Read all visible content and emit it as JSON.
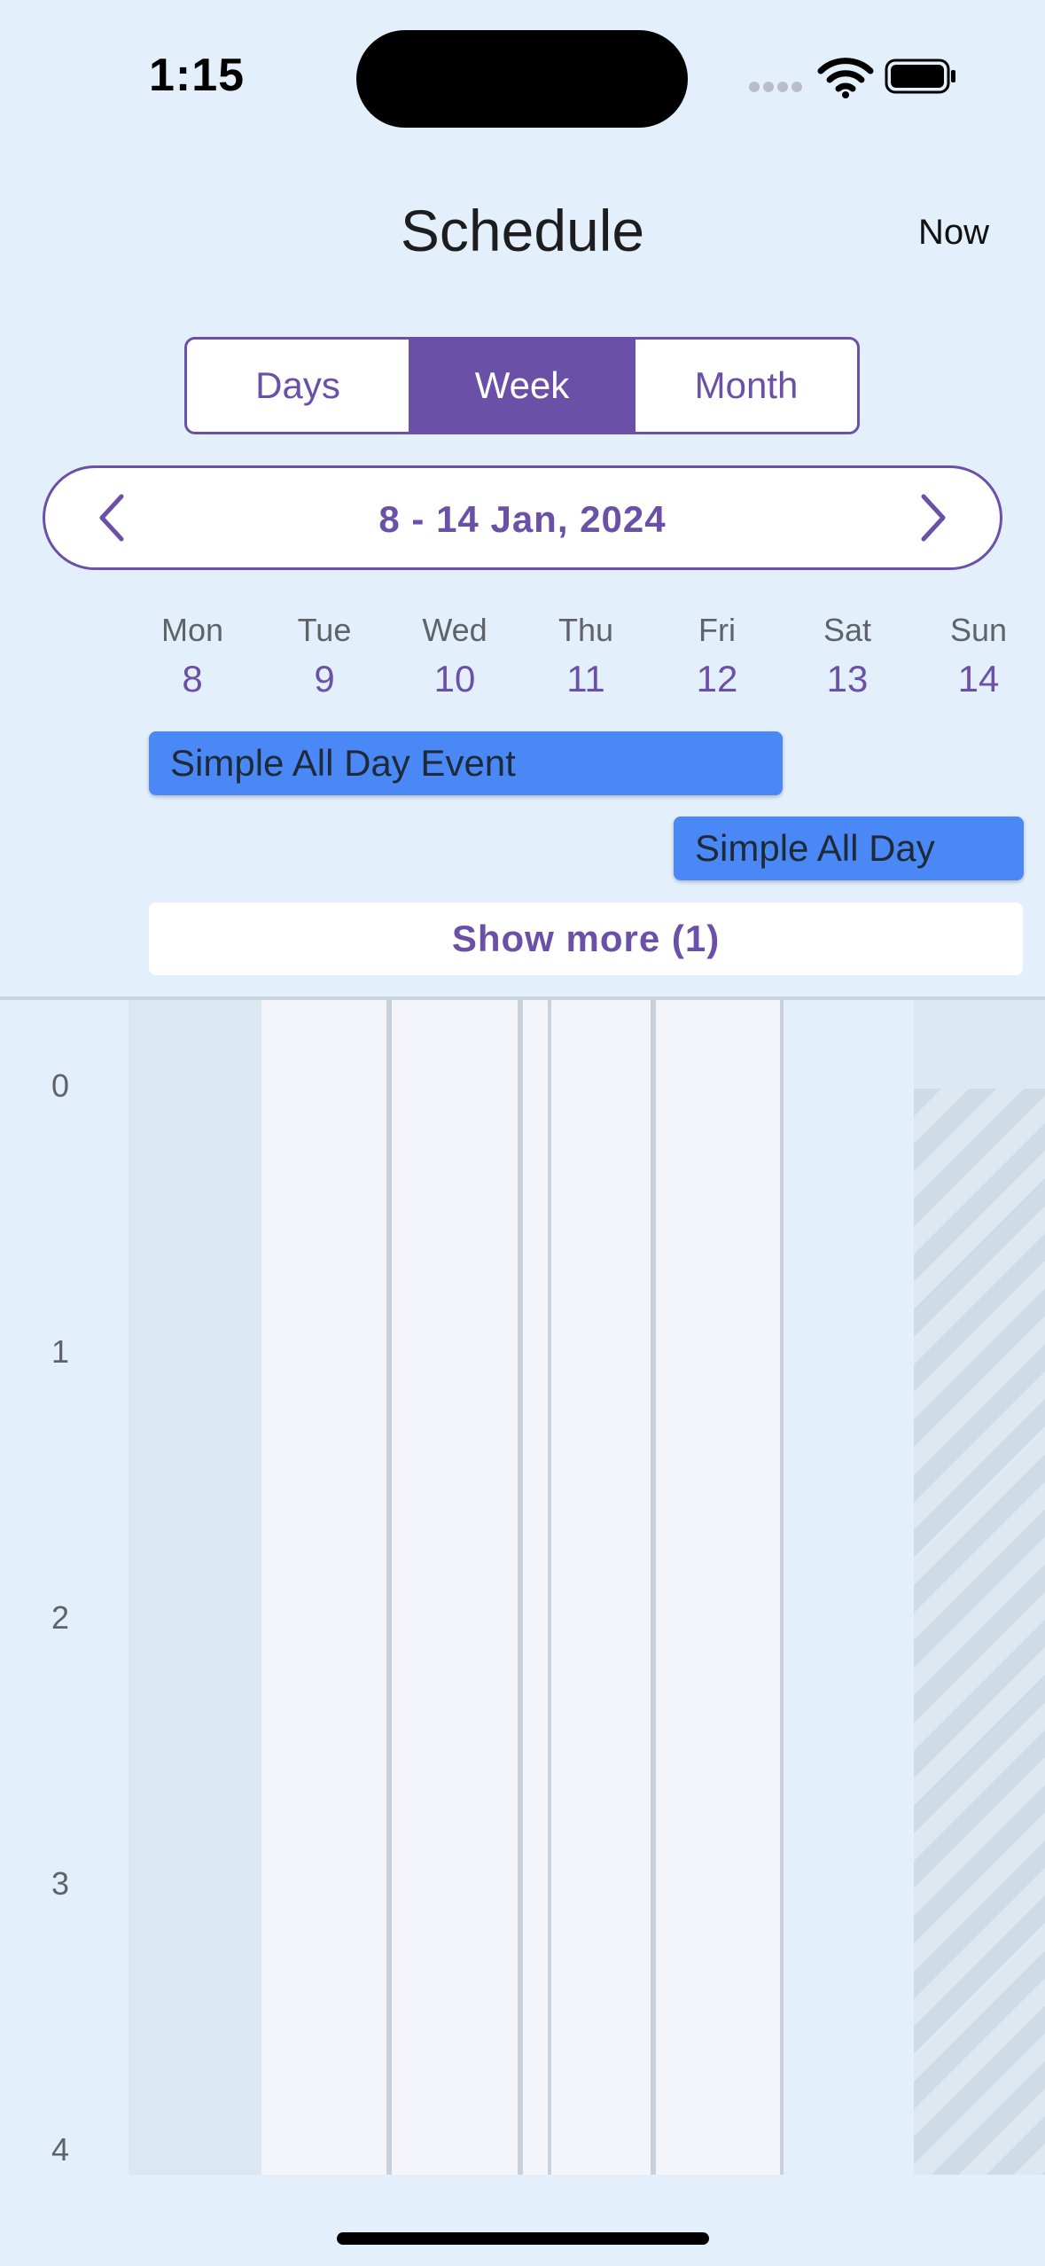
{
  "status_bar": {
    "time": "1:15"
  },
  "header": {
    "title": "Schedule",
    "now_label": "Now"
  },
  "view_switcher": {
    "days": "Days",
    "week": "Week",
    "month": "Month",
    "selected": "Week"
  },
  "date_range": {
    "label": "8 - 14 Jan, 2024"
  },
  "days": [
    {
      "name": "Mon",
      "num": "8"
    },
    {
      "name": "Tue",
      "num": "9"
    },
    {
      "name": "Wed",
      "num": "10"
    },
    {
      "name": "Thu",
      "num": "11"
    },
    {
      "name": "Fri",
      "num": "12"
    },
    {
      "name": "Sat",
      "num": "13"
    },
    {
      "name": "Sun",
      "num": "14"
    }
  ],
  "all_day_events": [
    {
      "title": "Simple All Day Event"
    },
    {
      "title": "Simple All Day"
    }
  ],
  "show_more": "Show more (1)",
  "hours": [
    "0",
    "1",
    "2",
    "3",
    "4"
  ],
  "colors": {
    "accent": "#6a50a7",
    "event": "#4a89f5",
    "background": "#e3f0fb"
  }
}
